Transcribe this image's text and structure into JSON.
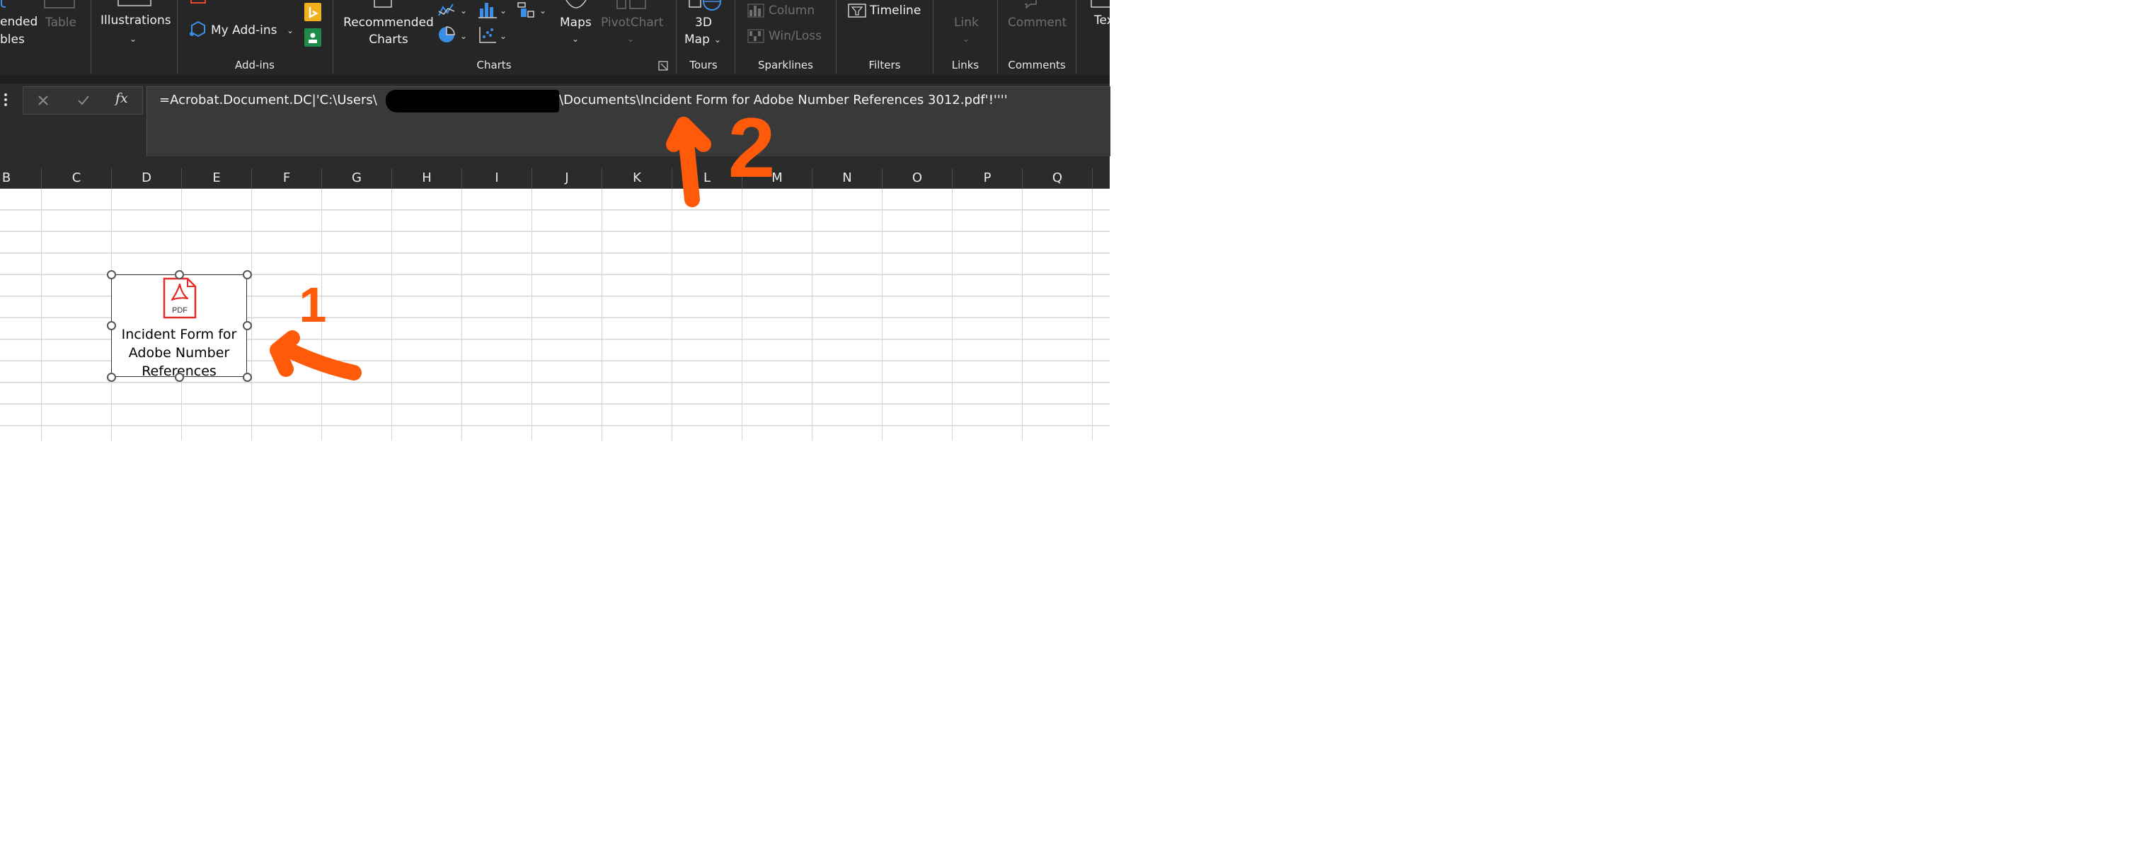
{
  "ribbon": {
    "pivot_partial_line1": "ended",
    "pivot_partial_line2": "bles",
    "table_label": "Table",
    "illustrations_label": "Illustrations",
    "my_addins_label": "My Add-ins",
    "addins_group": "Add-ins",
    "recommended_charts_line1": "Recommended",
    "recommended_charts_line2": "Charts",
    "maps_label": "Maps",
    "pivotchart_label": "PivotChart",
    "charts_group": "Charts",
    "map3d_line1": "3D",
    "map3d_line2": "Map",
    "tours_group": "Tours",
    "column_label": "Column",
    "winloss_label": "Win/Loss",
    "sparklines_group": "Sparklines",
    "timeline_label": "Timeline",
    "filters_group": "Filters",
    "link_label": "Link",
    "links_group": "Links",
    "comment_label": "Comment",
    "comments_group": "Comments",
    "text_partial": "Tex"
  },
  "formula_bar": {
    "fx_label": "fx",
    "formula_before": "=Acrobat.Document.DC|'C:\\Users\\",
    "formula_after": "\\Documents\\Incident Form for Adobe Number References 3012.pdf'!''''"
  },
  "columns": [
    "B",
    "C",
    "D",
    "E",
    "F",
    "G",
    "H",
    "I",
    "J",
    "K",
    "L",
    "M",
    "N",
    "O",
    "P",
    "Q"
  ],
  "embedded_object": {
    "icon_text": "PDF",
    "label": "Incident Form for Adobe Number References"
  },
  "annotations": {
    "arrow1_number": "1",
    "arrow2_number": "2",
    "color": "#ff5a0a"
  },
  "colors": {
    "ribbon_bg": "#262626",
    "pdf_red": "#e52d27",
    "accent_blue": "#3a8ee6"
  }
}
